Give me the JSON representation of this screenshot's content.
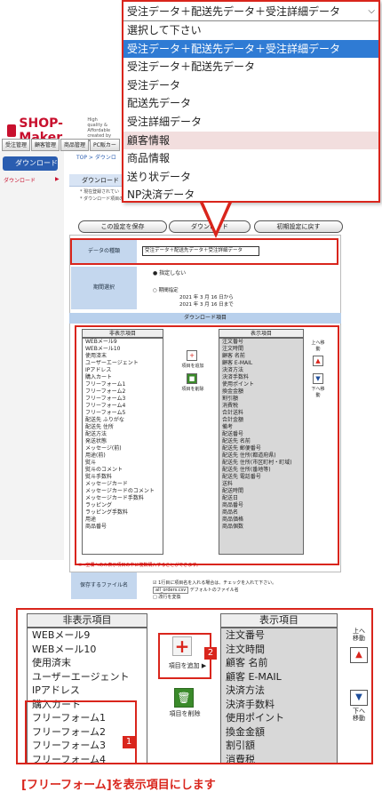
{
  "app": {
    "logo": "SHOP-Maker",
    "logo_sub": "High quality & Affordable created by A",
    "nav_tabs": [
      "受注管理",
      "顧客管理",
      "商品管理",
      "PC販カー"
    ],
    "sidebar_button": "ダウンロード",
    "sidebar_link": "ダウンロード",
    "breadcrumb": "TOP > ダウンロ",
    "section_title": "ダウンロード",
    "note1": "* 現在登録されてい",
    "note2": "* ダウンロード項目の並べ替え・非表示項目の移動",
    "buttons": {
      "save": "この設定を保存",
      "download": "ダウンロード",
      "reset": "初期設定に戻す"
    },
    "data_type_label": "データの種類",
    "data_type_value": "受注データ＋配送先データ＋受注詳細データ",
    "period_label": "期間選択",
    "period_none": "指定しない",
    "period_range_label": "期間指定",
    "period_from": "2021 年 3 月 16 日から",
    "period_to": "2021 年 3 月 16 日まで",
    "download_items_label": "ダウンロード項目",
    "hidden_header": "非表示項目",
    "shown_header": "表示項目",
    "hidden_items": [
      "WEBメール9",
      "WEBメール10",
      "使用済末",
      "ユーザーエージェント",
      "IPアドレス",
      "購入カート",
      "フリーフォーム1",
      "フリーフォーム2",
      "フリーフォーム3",
      "フリーフォーム4",
      "フリーフォーム5",
      "配送先 ふりがな",
      "配送先 住所",
      "配送方法",
      "発送状態",
      "メッセージ(前)",
      "用途(前)",
      "熨斗",
      "熨斗のコメント",
      "熨斗手数料",
      "メッセージカード",
      "メッセージカードのコメント",
      "メッセージカード手数料",
      "ラッピング",
      "ラッピング手数料",
      "用途",
      "商品番号"
    ],
    "shown_items": [
      "注文番号",
      "注文時間",
      "顧客 名前",
      "顧客 E-MAIL",
      "決済方法",
      "決済手数料",
      "使用ポイント",
      "換金金額",
      "割引額",
      "消費税",
      "合計送料",
      "合計金額",
      "備考",
      "配送番号",
      "配送先 名前",
      "配送先 郵便番号",
      "配送先 住所(都道府県)",
      "配送先 住所(市区町村・町域)",
      "配送先 住所(番地等)",
      "配送先 電話番号",
      "送料",
      "配送時間",
      "配送日",
      "商品番号",
      "商品名",
      "商品価格",
      "商品個数"
    ],
    "add_label": "項目を追加",
    "remove_label": "項目を削除",
    "up_label": "上へ移動",
    "down_label": "下へ移動",
    "footnote": "※→空欄へのみ表示項目の中に複数購入することができます。",
    "file_label": "保存するファイル名",
    "file_line1": "1行目に項目名を入れる場合は、チェックを入れて下さい。",
    "file_name": "all_orders.csv",
    "file_line2": "デフォルトのファイル名",
    "file_line3": "改行を変換"
  },
  "dropdown": {
    "selected": "受注データ＋配送先データ＋受注詳細データ",
    "options": [
      "選択して下さい",
      "受注データ＋配送先データ＋受注詳細データ",
      "受注データ＋配送先データ",
      "受注データ",
      "配送先データ",
      "受注詳細データ",
      "顧客情報",
      "商品情報",
      "送り状データ",
      "NP決済データ"
    ]
  },
  "zoom": {
    "hidden_header": "非表示項目",
    "shown_header": "表示項目",
    "hidden_items": [
      "WEBメール9",
      "WEBメール10",
      "使用済末",
      "ユーザーエージェント",
      "IPアドレス",
      "購入カート",
      "フリーフォーム1",
      "フリーフォーム2",
      "フリーフォーム3",
      "フリーフォーム4",
      "フリーフォーム5"
    ],
    "shown_items": [
      "注文番号",
      "注文時間",
      "顧客 名前",
      "顧客 E-MAIL",
      "決済方法",
      "決済手数料",
      "使用ポイント",
      "換金金額",
      "割引額",
      "消費税",
      "合計送料"
    ],
    "add_label": "項目を追加",
    "remove_label": "項目を削除",
    "up_label": "上へ移動",
    "down_label": "下へ移動",
    "badge1": "1",
    "badge2": "2"
  },
  "caption": "[フリーフォーム]を表示項目にします",
  "colors": {
    "accent_red": "#d9251c",
    "select_blue": "#2f7bd4"
  }
}
